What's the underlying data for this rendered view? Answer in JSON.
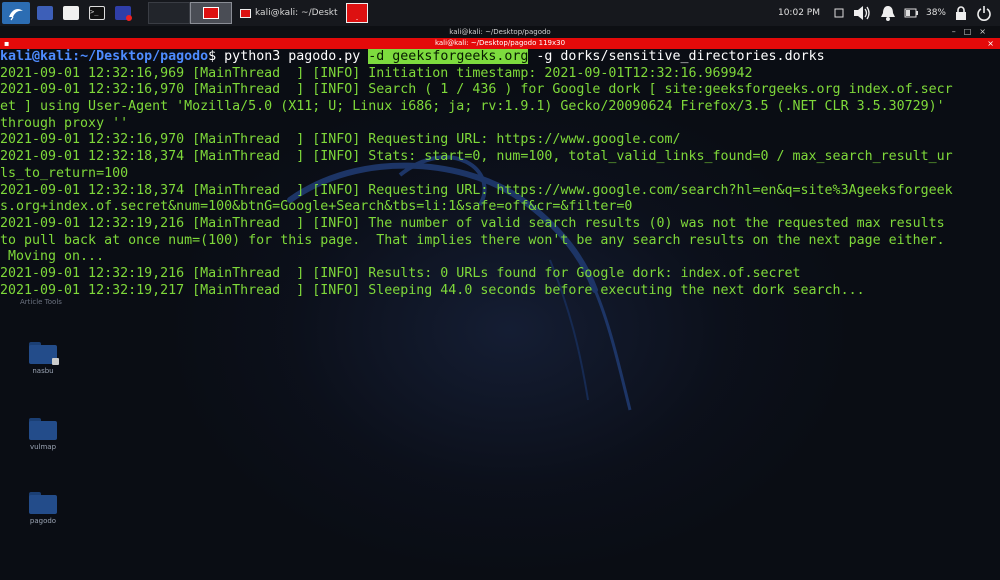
{
  "taskbar": {
    "task_title": "kali@kali: ~/Desktop/pa...",
    "clock": "10:02 PM",
    "battery": "38%",
    "colors": {
      "accent": "#2c6db3",
      "alert": "#d11111"
    },
    "icons": [
      "kali-menu-icon",
      "workspace-icon",
      "folder-icon",
      "terminal-icon",
      "screen-recorder-icon",
      "network-icon",
      "volume-icon",
      "notification-icon",
      "battery-icon",
      "lock-icon",
      "power-icon"
    ]
  },
  "window": {
    "title": "kali@kali: ~/Desktop/pagodo",
    "tab_title": "kali@kali: ~/Desktop/pagodo 119x30"
  },
  "desktop": {
    "article_tools": "Article Tools",
    "icons": [
      {
        "label": "nasbu"
      },
      {
        "label": "vulmap"
      },
      {
        "label": "pagodo"
      }
    ]
  },
  "terminal": {
    "prompt_user": "kali@kali",
    "prompt_path": ":~/Desktop/pagodo",
    "prompt_symbol": "$",
    "cmd_pre": " python3 pagodo.py ",
    "cmd_highlight": "-d geeksforgeeks.org",
    "cmd_post": " -g dorks/sensitive_directories.dorks",
    "lines": [
      "2021-09-01 12:32:16,969 [MainThread  ] [INFO] Initiation timestamp: 2021-09-01T12:32:16.969942",
      "2021-09-01 12:32:16,970 [MainThread  ] [INFO] Search ( 1 / 436 ) for Google dork [ site:geeksforgeeks.org index.of.secr",
      "et ] using User-Agent 'Mozilla/5.0 (X11; U; Linux i686; ja; rv:1.9.1) Gecko/20090624 Firefox/3.5 (.NET CLR 3.5.30729)'",
      "through proxy ''",
      "2021-09-01 12:32:16,970 [MainThread  ] [INFO] Requesting URL: https://www.google.com/",
      "2021-09-01 12:32:18,374 [MainThread  ] [INFO] Stats: start=0, num=100, total_valid_links_found=0 / max_search_result_ur",
      "ls_to_return=100",
      "2021-09-01 12:32:18,374 [MainThread  ] [INFO] Requesting URL: https://www.google.com/search?hl=en&q=site%3Ageeksforgeek",
      "s.org+index.of.secret&num=100&btnG=Google+Search&tbs=li:1&safe=off&cr=&filter=0",
      "2021-09-01 12:32:19,216 [MainThread  ] [INFO] The number of valid search results (0) was not the requested max results",
      "to pull back at once num=(100) for this page.  That implies there won't be any search results on the next page either.",
      " Moving on...",
      "2021-09-01 12:32:19,216 [MainThread  ] [INFO] Results: 0 URLs found for Google dork: index.of.secret",
      "2021-09-01 12:32:19,217 [MainThread  ] [INFO] Sleeping 44.0 seconds before executing the next dork search..."
    ]
  }
}
